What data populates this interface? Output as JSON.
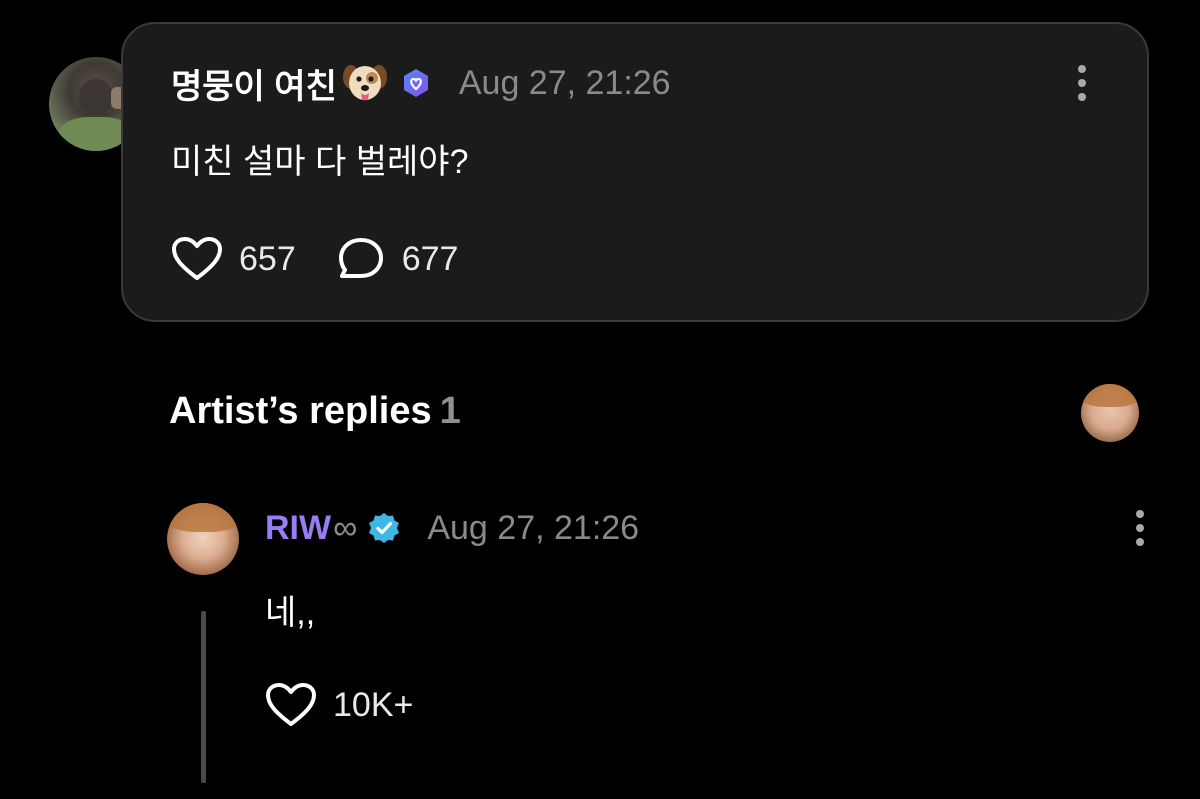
{
  "post": {
    "author_name": "명뭉이 여친",
    "author_emoji": "puppy-face-emoji",
    "badge": "purple-verified-badge",
    "timestamp": "Aug 27, 21:26",
    "text": "미친 설마 다 벌레야?",
    "likes": "657",
    "comments": "677",
    "icons": {
      "like": "heart-icon",
      "comment": "speech-bubble-icon",
      "more": "more-vertical-icon"
    }
  },
  "artist_replies": {
    "title": "Artist’s replies",
    "count": "1",
    "reply": {
      "author_name": "RIW",
      "author_suffix": "∞",
      "badge": "blue-verified-badge",
      "timestamp": "Aug 27, 21:26",
      "text": "네,,",
      "likes": "10K+"
    }
  },
  "colors": {
    "background": "#000000",
    "card_background": "#1b1b1b",
    "card_border": "#3a3a3a",
    "artist_name": "#9a7cf4",
    "verified_blue": "#3fb7e6",
    "badge_purple": "#6a5cf0",
    "muted_text": "#8a8a8a"
  }
}
